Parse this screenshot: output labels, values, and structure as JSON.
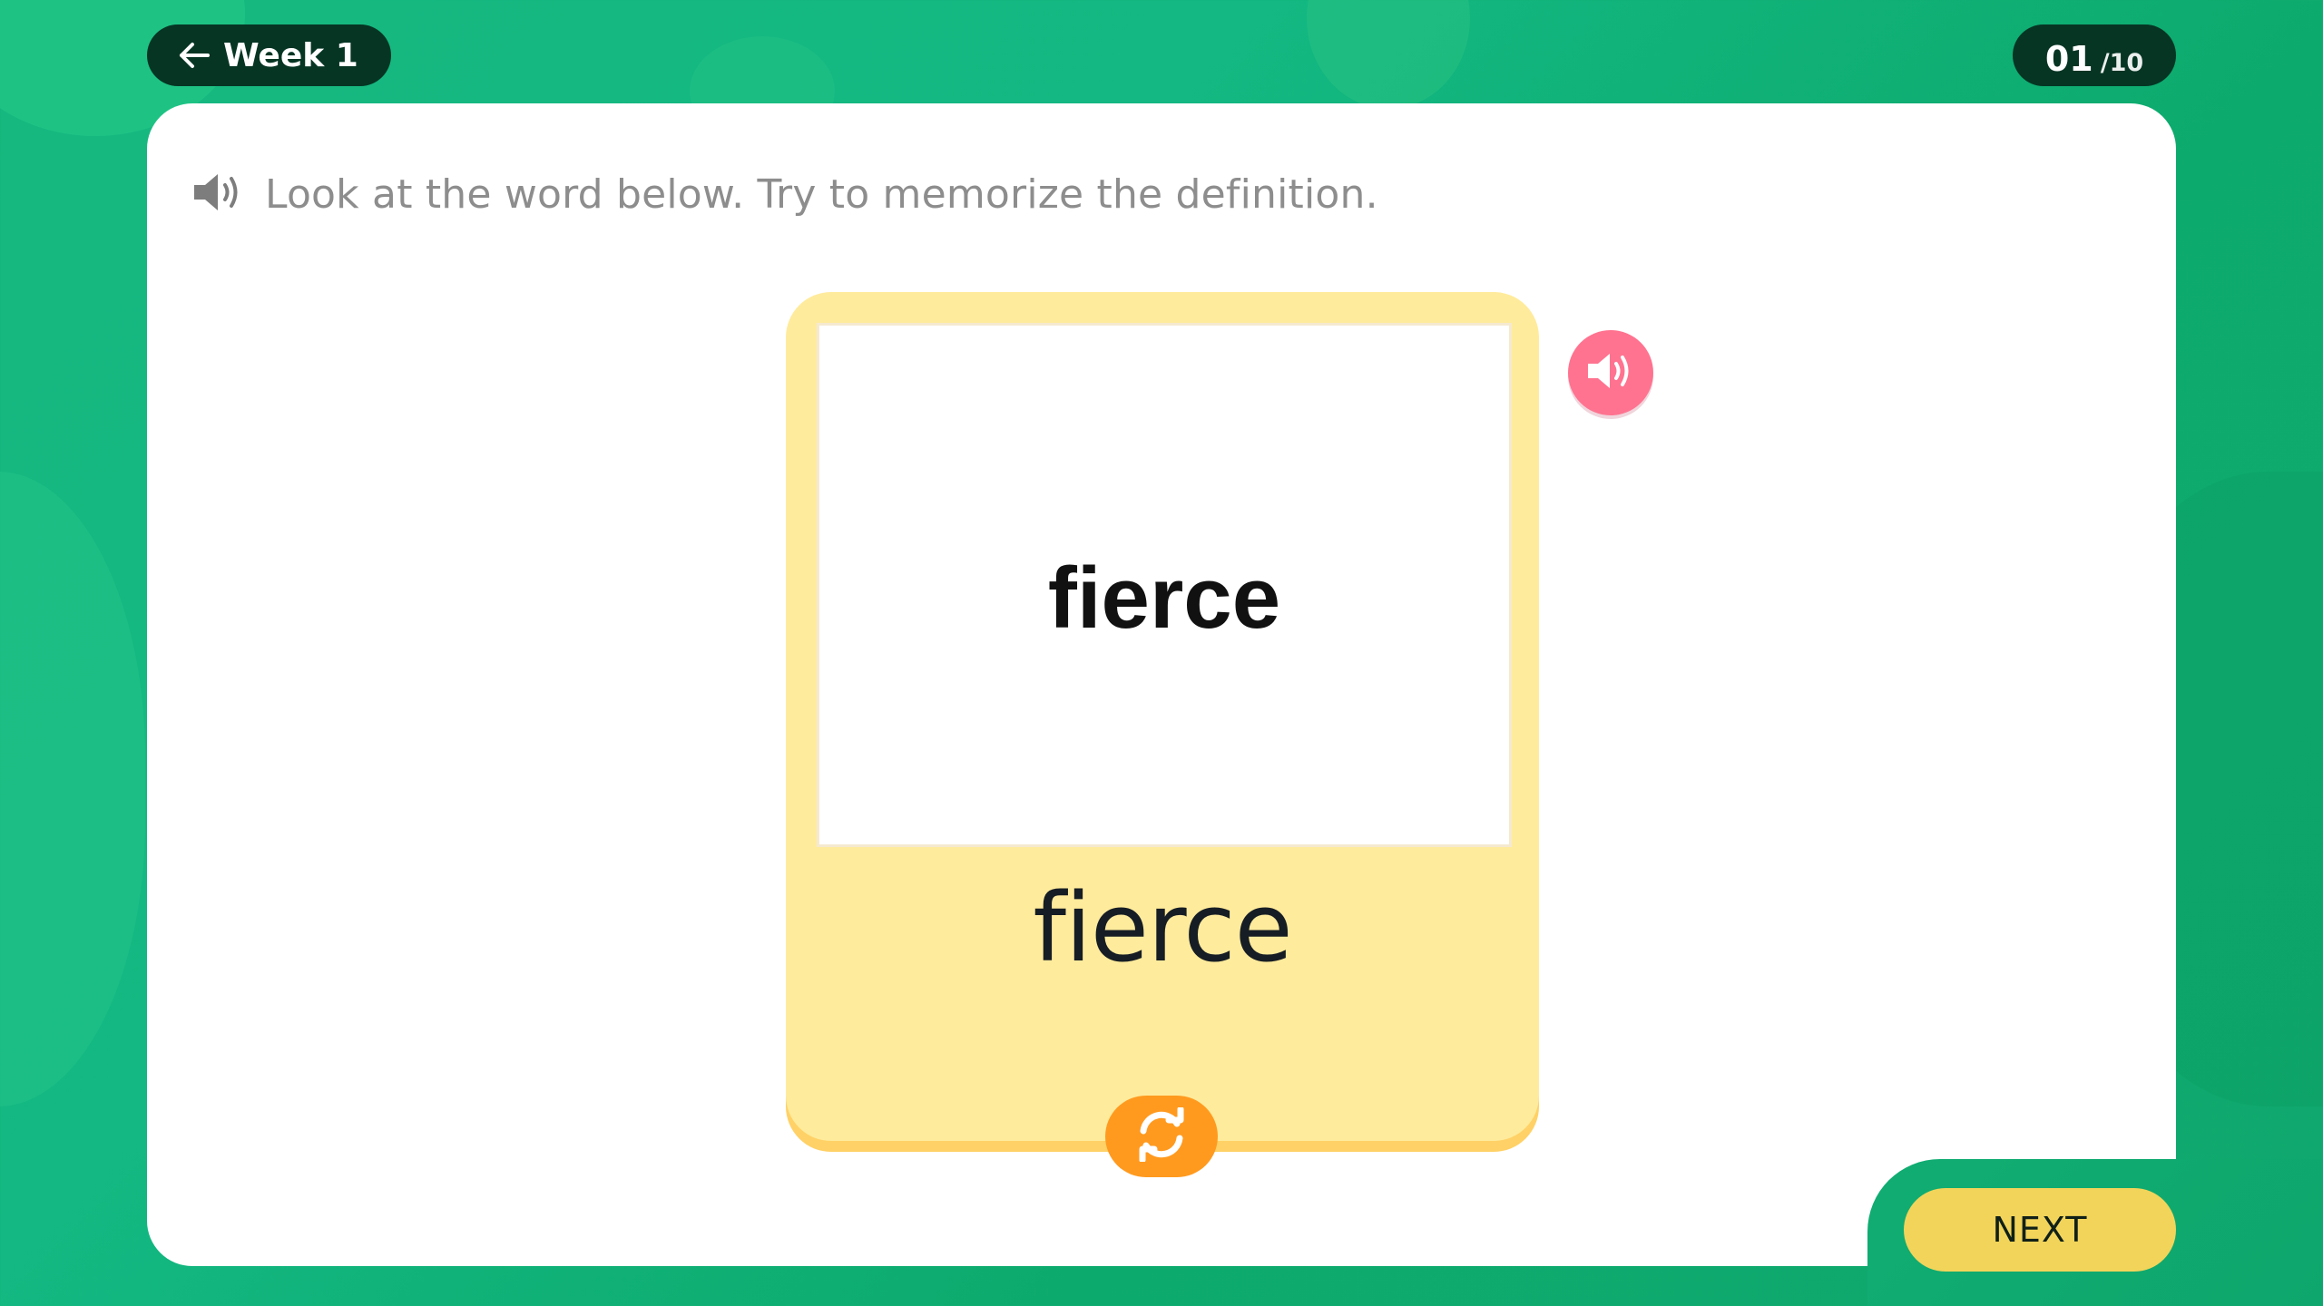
{
  "header": {
    "back_label": "Week 1",
    "progress_current": "01",
    "progress_total": "/10"
  },
  "instruction": {
    "text": "Look at the word below. Try to memorize the definition.",
    "icon": "speaker-icon"
  },
  "flashcard": {
    "image_word": "fierce",
    "word": "fierce",
    "audio_icon": "speaker-icon",
    "flip_icon": "refresh-icon"
  },
  "footer": {
    "next_label": "NEXT"
  },
  "colors": {
    "background": "#13b882",
    "header_pill": "#063524",
    "card": "#ffeb9c",
    "card_shadow": "#ffd166",
    "flip_button": "#ff9a1f",
    "audio_button": "#ff7390",
    "next_button": "#f2d45a"
  }
}
